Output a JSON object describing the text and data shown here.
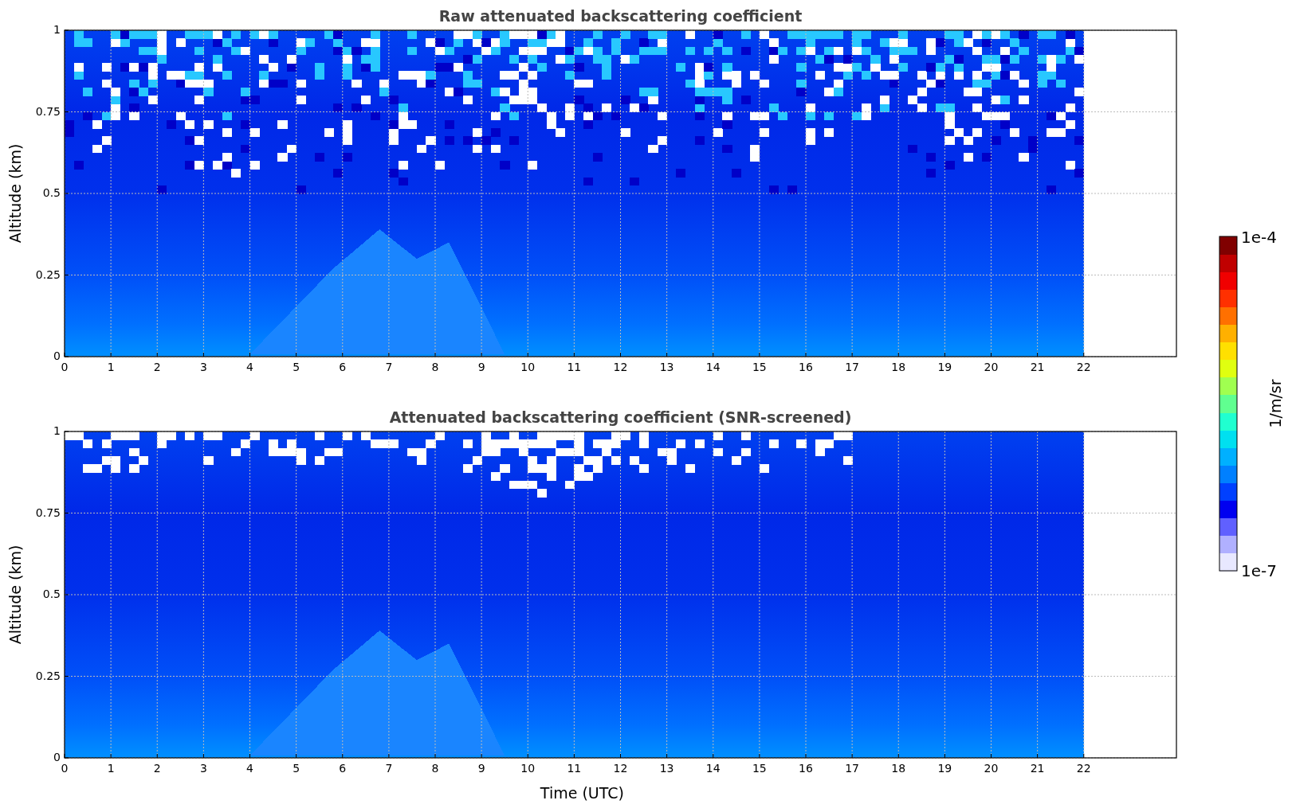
{
  "panels": [
    {
      "kind": "raw",
      "title": "Raw attenuated backscattering coefficient",
      "ylabel": "Altitude (km)",
      "yticks": [
        "1",
        "0.75",
        "0.5",
        "0.25",
        "0"
      ],
      "xticks": [
        "0",
        "1",
        "2",
        "3",
        "4",
        "5",
        "6",
        "7",
        "8",
        "9",
        "10",
        "11",
        "12",
        "13",
        "14",
        "15",
        "16",
        "17",
        "18",
        "19",
        "20",
        "21",
        "22"
      ]
    },
    {
      "kind": "screened",
      "title": "Attenuated backscattering coefficient (SNR-screened)",
      "ylabel": "Altitude (km)",
      "yticks": [
        "1",
        "0.75",
        "0.5",
        "0.25",
        "0"
      ],
      "xticks": [
        "0",
        "1",
        "2",
        "3",
        "4",
        "5",
        "6",
        "7",
        "8",
        "9",
        "10",
        "11",
        "12",
        "13",
        "14",
        "15",
        "16",
        "17",
        "18",
        "19",
        "20",
        "21",
        "22"
      ]
    }
  ],
  "xlabel": "Time (UTC)",
  "colorbar": {
    "max": "1e-4",
    "min": "1e-7",
    "label": "1/m/sr"
  }
}
